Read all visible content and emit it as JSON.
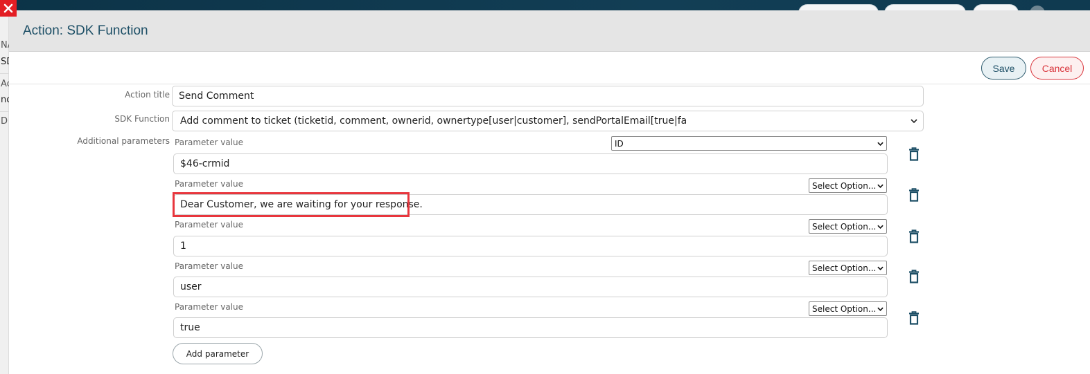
{
  "modal": {
    "title": "Action: SDK Function",
    "save_label": "Save",
    "cancel_label": "Cancel"
  },
  "background": {
    "left_fragments": [
      "NA",
      "SD",
      "Ac",
      "nc",
      "D"
    ]
  },
  "form": {
    "action_title_label": "Action title",
    "action_title_value": "Send Comment",
    "sdk_function_label": "SDK Function",
    "sdk_function_value": "Add comment to ticket (ticketid, comment, ownerid, ownertype[user|customer], sendPortalEmail[true|fa",
    "additional_parameters_label": "Additional parameters",
    "add_parameter_label": "Add parameter"
  },
  "parameters": [
    {
      "label": "Parameter value",
      "select_value": "ID",
      "value": "$46-crmid"
    },
    {
      "label": "Parameter value",
      "select_value": "Select Option...",
      "value": "Dear Customer, we are waiting for your response."
    },
    {
      "label": "Parameter value",
      "select_value": "Select Option...",
      "value": "1"
    },
    {
      "label": "Parameter value",
      "select_value": "Select Option...",
      "value": "user"
    },
    {
      "label": "Parameter value",
      "select_value": "Select Option...",
      "value": "true"
    }
  ],
  "colors": {
    "accent": "#1d4f66",
    "danger": "#d9343b",
    "highlight": "#e8363d"
  },
  "icons": {
    "close": "close-icon",
    "delete": "trash-icon",
    "dropdown": "chevron-down-icon"
  }
}
